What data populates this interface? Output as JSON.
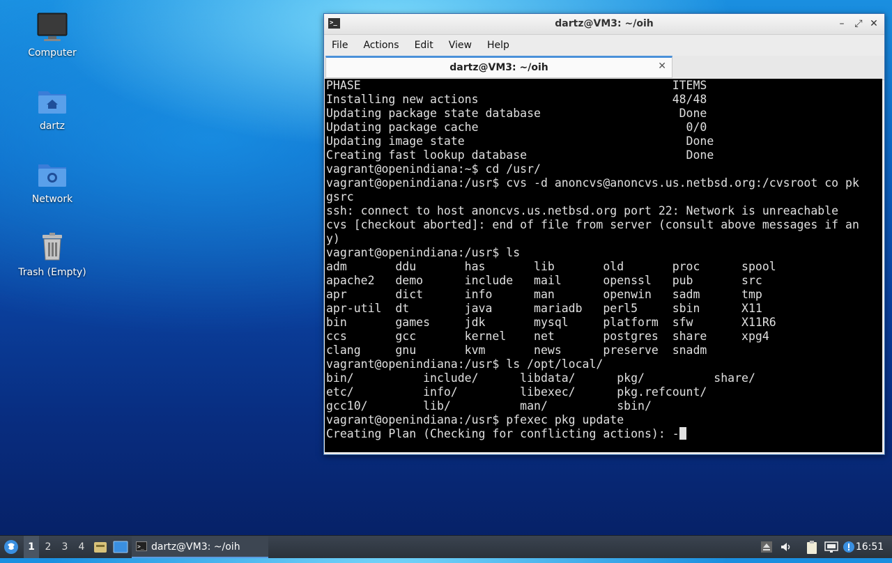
{
  "desktop": {
    "icons": [
      {
        "label": "Computer"
      },
      {
        "label": "dartz"
      },
      {
        "label": "Network"
      },
      {
        "label": "Trash (Empty)"
      }
    ]
  },
  "window": {
    "title": "dartz@VM3: ~/oih",
    "menu": [
      "File",
      "Actions",
      "Edit",
      "View",
      "Help"
    ],
    "tab_label": "dartz@VM3: ~/oih",
    "terminal_lines": [
      "PHASE                                             ITEMS",
      "Installing new actions                            48/48",
      "Updating package state database                    Done",
      "Updating package cache                              0/0",
      "Updating image state                                Done",
      "Creating fast lookup database                       Done",
      "vagrant@openindiana:~$ cd /usr/",
      "vagrant@openindiana:/usr$ cvs -d anoncvs@anoncvs.us.netbsd.org:/cvsroot co pk",
      "gsrc",
      "ssh: connect to host anoncvs.us.netbsd.org port 22: Network is unreachable",
      "cvs [checkout aborted]: end of file from server (consult above messages if an",
      "y)",
      "vagrant@openindiana:/usr$ ls",
      "adm       ddu       has       lib       old       proc      spool",
      "apache2   demo      include   mail      openssl   pub       src",
      "apr       dict      info      man       openwin   sadm      tmp",
      "apr-util  dt        java      mariadb   perl5     sbin      X11",
      "bin       games     jdk       mysql     platform  sfw       X11R6",
      "ccs       gcc       kernel    net       postgres  share     xpg4",
      "clang     gnu       kvm       news      preserve  snadm",
      "vagrant@openindiana:/usr$ ls /opt/local/",
      "bin/          include/      libdata/      pkg/          share/",
      "etc/          info/         libexec/      pkg.refcount/",
      "gcc10/        lib/          man/          sbin/",
      "vagrant@openindiana:/usr$ pfexec pkg update",
      "Creating Plan (Checking for conflicting actions): -"
    ]
  },
  "taskbar": {
    "workspaces": [
      "1",
      "2",
      "3",
      "4"
    ],
    "active_workspace": "1",
    "task_label": "dartz@VM3: ~/oih",
    "clock": "16:51"
  }
}
